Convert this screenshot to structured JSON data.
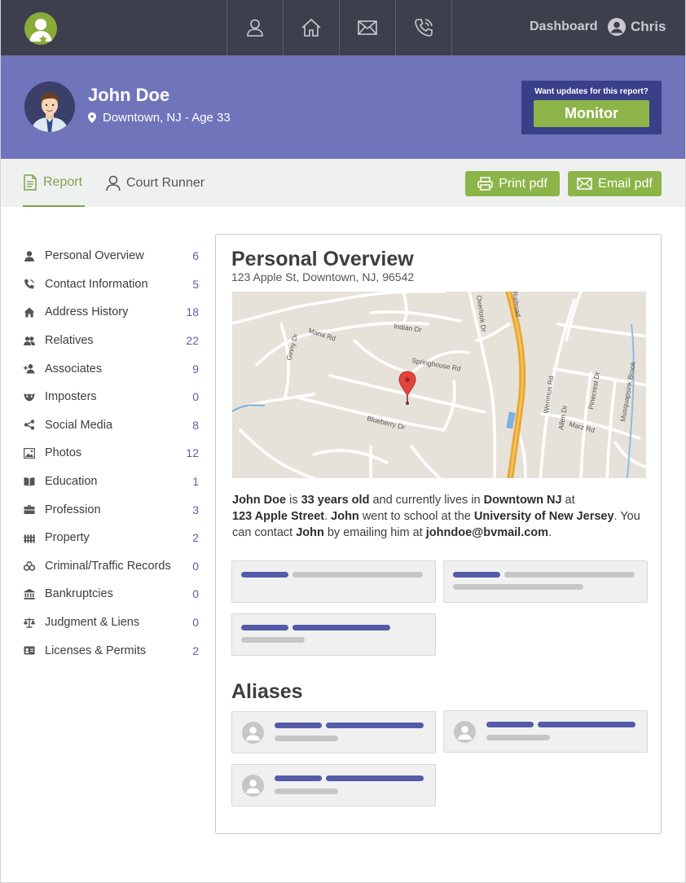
{
  "nav": {
    "icons": [
      "user-icon",
      "home-icon",
      "mail-icon",
      "phone-icon"
    ],
    "dashboard_label": "Dashboard",
    "user_name": "Chris"
  },
  "profile": {
    "name": "John Doe",
    "location": "Downtown, NJ - Age 33",
    "monitor_prompt": "Want updates for this report?",
    "monitor_label": "Monitor"
  },
  "tabs": {
    "report_label": "Report",
    "court_label": "Court Runner",
    "print_label": "Print pdf",
    "email_label": "Email pdf"
  },
  "sidebar": {
    "items": [
      {
        "label": "Personal Overview",
        "count": "6",
        "icon": "person-icon"
      },
      {
        "label": "Contact Information",
        "count": "5",
        "icon": "phone-icon"
      },
      {
        "label": "Address History",
        "count": "18",
        "icon": "house-icon"
      },
      {
        "label": "Relatives",
        "count": "22",
        "icon": "group-icon"
      },
      {
        "label": "Associates",
        "count": "9",
        "icon": "add-person-icon"
      },
      {
        "label": "Imposters",
        "count": "0",
        "icon": "mask-icon"
      },
      {
        "label": "Social Media",
        "count": "8",
        "icon": "share-icon"
      },
      {
        "label": "Photos",
        "count": "12",
        "icon": "image-icon"
      },
      {
        "label": "Education",
        "count": "1",
        "icon": "book-icon"
      },
      {
        "label": "Profession",
        "count": "3",
        "icon": "briefcase-icon"
      },
      {
        "label": "Property",
        "count": "2",
        "icon": "fence-icon"
      },
      {
        "label": "Criminal/Traffic Records",
        "count": "0",
        "icon": "handcuffs-icon"
      },
      {
        "label": "Bankruptcies",
        "count": "0",
        "icon": "bank-icon"
      },
      {
        "label": "Judgment & Liens",
        "count": "0",
        "icon": "scale-icon"
      },
      {
        "label": "Licenses & Permits",
        "count": "2",
        "icon": "id-card-icon"
      }
    ]
  },
  "overview": {
    "title": "Personal Overview",
    "address": "123 Apple St, Downtown, NJ, 96542",
    "map_labels": [
      "Indian Dr",
      "Maria Rd",
      "Ginny Dr",
      "Springhouse Rd",
      "Blueberry Dr",
      "Overlook Dr",
      "Railroad",
      "Werimus Rd",
      "Allen Dr",
      "Marz Rd",
      "Pinecrest Dr",
      "Musquapsink Brook"
    ],
    "bio": {
      "p1": "John Doe",
      "p2": " is ",
      "p3": "33 years old",
      "p4": " and currently lives in ",
      "p5": "Downtown NJ",
      "p6": " at ",
      "p7": "123 Apple Street",
      "p8": ". ",
      "p9": "John",
      "p10": " went to school at the ",
      "p11": "University of New Jersey",
      "p12": ". You can contact ",
      "p13": "John",
      "p14": " by emailing him at ",
      "p15": "johndoe@bvmail.com",
      "p16": "."
    }
  },
  "aliases": {
    "title": "Aliases"
  }
}
